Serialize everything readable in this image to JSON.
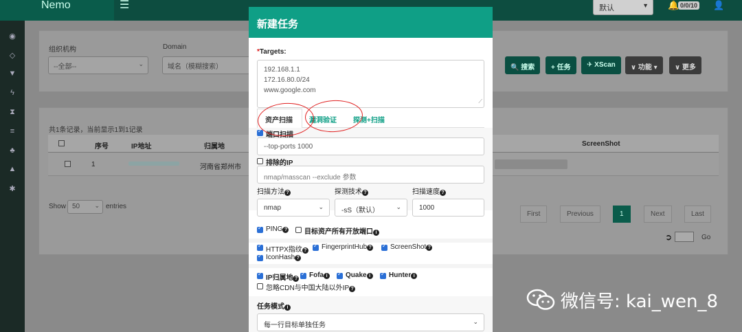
{
  "topbar": {
    "brand": "Nemo",
    "menu_icon": "hamburger-icon",
    "default_select": "默认",
    "notification_badge": "0/0/10"
  },
  "filters": {
    "org_label": "组织机构",
    "org_value": "--全部--",
    "domain_label": "Domain",
    "domain_placeholder": "域名（模糊搜索）",
    "buttons": {
      "search": "搜索",
      "task": "任务",
      "xscan": "XScan",
      "function": "功能",
      "more": "更多"
    }
  },
  "table": {
    "summary": "共1条记录，当前显示1到1记录",
    "columns": [
      "序号",
      "IP地址",
      "归属地",
      "ScreenShot"
    ],
    "rows": [
      {
        "index": "1",
        "location": "河南省郑州市"
      }
    ],
    "show_label": "Show",
    "entries_value": "50",
    "entries_label": "entries",
    "pager": {
      "first": "First",
      "previous": "Previous",
      "page": "1",
      "next": "Next",
      "last": "Last",
      "go": "Go"
    }
  },
  "modal": {
    "title": "新建任务",
    "targets_label": "Targets:",
    "targets_required": "*",
    "targets_lines": [
      "192.168.1.1",
      "172.16.80.0/24",
      "www.google.com"
    ],
    "tabs": [
      "资产扫描",
      "漏洞验证",
      "探测+扫描"
    ],
    "port_scan_label": "端口扫描",
    "port_scan_value": "--top-ports 1000",
    "exclude_ip_label": "排除的IP",
    "exclude_ip_placeholder": "nmap/masscan --exclude 参数",
    "scan_method_label": "扫描方法",
    "scan_method_value": "nmap",
    "probe_tech_label": "探测技术",
    "probe_tech_value": "-sS（默认）",
    "scan_speed_label": "扫描速度",
    "scan_speed_value": "1000",
    "ping_label": "PING",
    "all_open_ports_label": "目标资产所有开放端口",
    "httpx_label": "HTTPX指纹",
    "fingerprinthub_label": "FingerprintHub",
    "screenshot_label": "ScreenShot",
    "iconhash_label": "IconHash",
    "ip_location_label": "IP归属地",
    "fofa_label": "Fofa",
    "quake_label": "Quake",
    "hunter_label": "Hunter",
    "ignore_cdn_label": "忽略CDN与中国大陆以外IP",
    "task_mode_label": "任务模式",
    "task_mode_value": "每一行目标单独任务"
  },
  "watermark": "微信号: kai_wen_8",
  "colors": {
    "modal_header": "#0f9f86",
    "checkbox": "#2a6fd6",
    "annotation": "#e02020",
    "dark_button": "#0a4f42"
  }
}
